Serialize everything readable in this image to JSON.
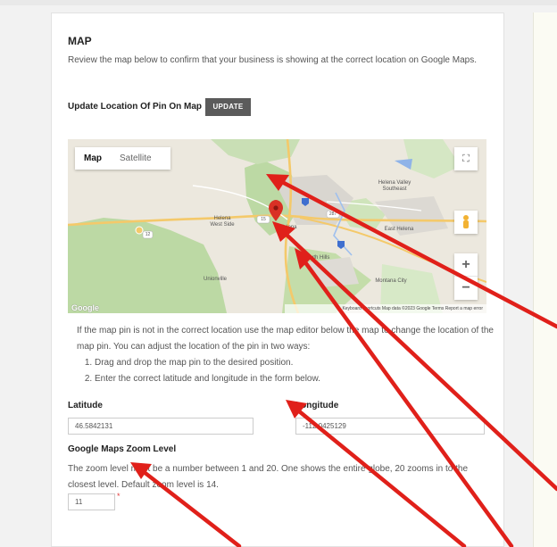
{
  "section": {
    "title": "MAP",
    "intro": "Review the map below to confirm that your business is showing at the correct location on Google Maps."
  },
  "update": {
    "label": "Update Location Of Pin On Map",
    "button": "UPDATE"
  },
  "map": {
    "tabs": [
      "Map",
      "Satellite"
    ],
    "labels": {
      "helena_valley": "Helena Valley\nSoutheast",
      "helena_west": "Helena\nWest Side",
      "helena": "Helena",
      "east_helena": "East Helena",
      "south_hills": "South Hills",
      "unionville": "Unionville",
      "montana_city": "Montana City",
      "road_12": "12",
      "road_15": "15",
      "road_287": "287"
    },
    "footer": "Keyboard shortcuts   Map data ©2023 Google   Terms   Report a map error",
    "logo": "Google"
  },
  "help": {
    "text": "If the map pin is not in the correct location use the map editor below the map to change the location of the map pin. You can adjust the location of the pin in two ways:",
    "steps": [
      "Drag and drop the map pin to the desired position.",
      "Enter the correct latitude and longitude in the form below."
    ]
  },
  "latitude": {
    "label": "Latitude",
    "value": "46.5842131"
  },
  "longitude": {
    "label": "Longitude",
    "value": "-112.0425129"
  },
  "zoom": {
    "label": "Google Maps Zoom Level",
    "help": "The zoom level must be a number between 1 and 20. One shows the entire globe, 20 zooms in to the closest level. Default zoom level is 14.",
    "value": "11",
    "required": "*"
  },
  "colors": {
    "arrow": "#e0201a",
    "button": "#5b5b5b",
    "pin": "#d93025",
    "forest": "#bcd9a4"
  }
}
